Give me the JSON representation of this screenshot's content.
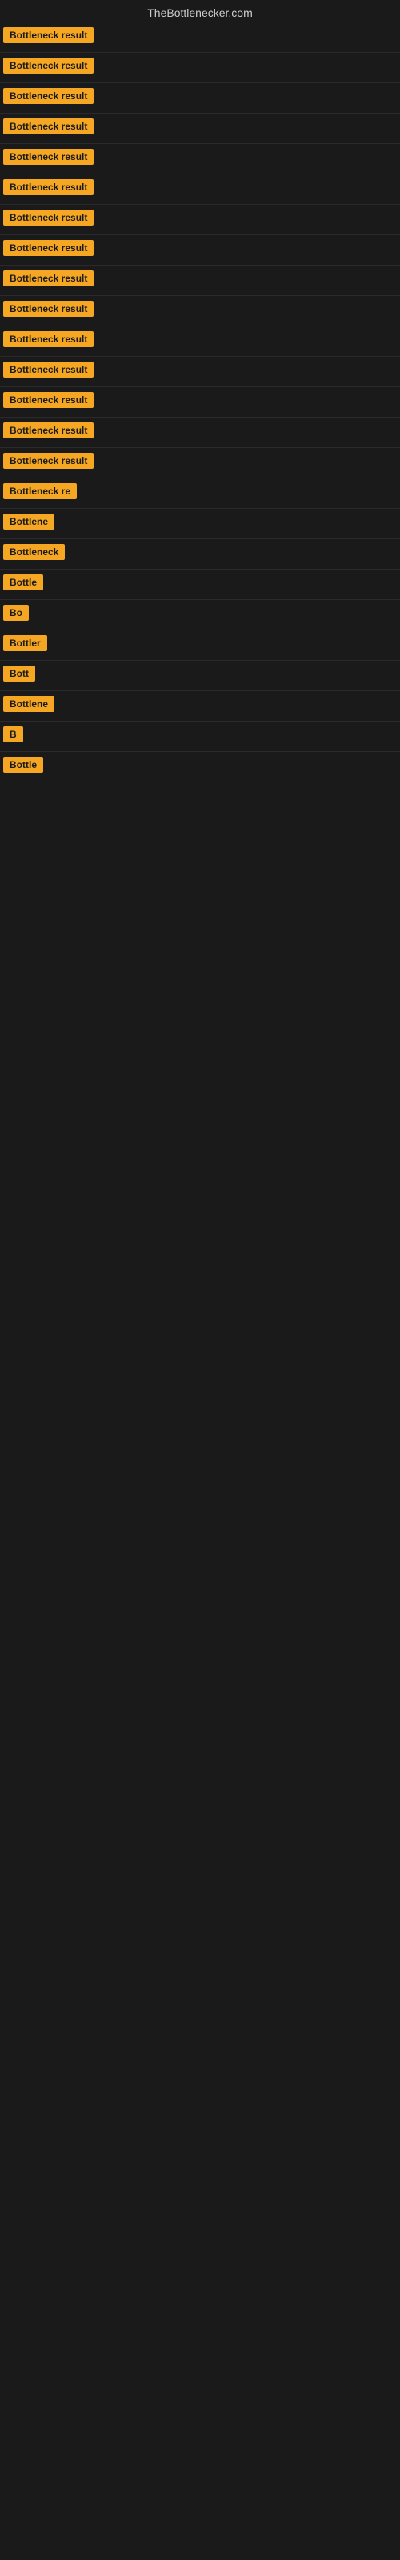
{
  "site": {
    "title": "TheBottlenecker.com"
  },
  "rows": [
    {
      "id": 1,
      "label": "Bottleneck result",
      "truncated": false
    },
    {
      "id": 2,
      "label": "Bottleneck result",
      "truncated": false
    },
    {
      "id": 3,
      "label": "Bottleneck result",
      "truncated": false
    },
    {
      "id": 4,
      "label": "Bottleneck result",
      "truncated": false
    },
    {
      "id": 5,
      "label": "Bottleneck result",
      "truncated": false
    },
    {
      "id": 6,
      "label": "Bottleneck result",
      "truncated": false
    },
    {
      "id": 7,
      "label": "Bottleneck result",
      "truncated": false
    },
    {
      "id": 8,
      "label": "Bottleneck result",
      "truncated": false
    },
    {
      "id": 9,
      "label": "Bottleneck result",
      "truncated": false
    },
    {
      "id": 10,
      "label": "Bottleneck result",
      "truncated": false
    },
    {
      "id": 11,
      "label": "Bottleneck result",
      "truncated": false
    },
    {
      "id": 12,
      "label": "Bottleneck result",
      "truncated": false
    },
    {
      "id": 13,
      "label": "Bottleneck result",
      "truncated": false
    },
    {
      "id": 14,
      "label": "Bottleneck result",
      "truncated": false
    },
    {
      "id": 15,
      "label": "Bottleneck result",
      "truncated": false
    },
    {
      "id": 16,
      "label": "Bottleneck re",
      "truncated": true
    },
    {
      "id": 17,
      "label": "Bottlene",
      "truncated": true
    },
    {
      "id": 18,
      "label": "Bottleneck",
      "truncated": true
    },
    {
      "id": 19,
      "label": "Bottle",
      "truncated": true
    },
    {
      "id": 20,
      "label": "Bo",
      "truncated": true
    },
    {
      "id": 21,
      "label": "Bottler",
      "truncated": true
    },
    {
      "id": 22,
      "label": "Bott",
      "truncated": true
    },
    {
      "id": 23,
      "label": "Bottlene",
      "truncated": true
    },
    {
      "id": 24,
      "label": "B",
      "truncated": true
    },
    {
      "id": 25,
      "label": "Bottle",
      "truncated": true
    }
  ]
}
